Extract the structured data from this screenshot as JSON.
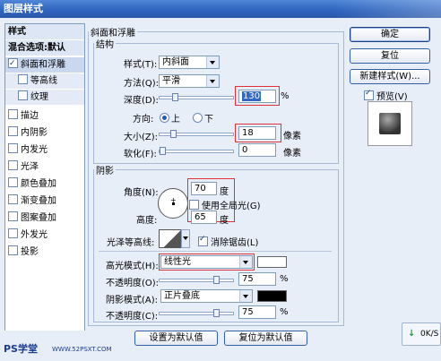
{
  "window": {
    "title": "图层样式"
  },
  "sidebar": {
    "header": "样式",
    "blend_options": "混合选项:默认",
    "items": [
      {
        "label": "斜面和浮雕",
        "checked": true,
        "selected": true
      },
      {
        "label": "等高线",
        "checked": false,
        "sub": true
      },
      {
        "label": "纹理",
        "checked": false,
        "sub": true
      },
      {
        "label": "描边",
        "checked": false
      },
      {
        "label": "内阴影",
        "checked": false
      },
      {
        "label": "内发光",
        "checked": false
      },
      {
        "label": "光泽",
        "checked": false
      },
      {
        "label": "颜色叠加",
        "checked": false
      },
      {
        "label": "渐变叠加",
        "checked": false
      },
      {
        "label": "图案叠加",
        "checked": false
      },
      {
        "label": "外发光",
        "checked": false
      },
      {
        "label": "投影",
        "checked": false
      }
    ]
  },
  "bevel": {
    "group_title": "斜面和浮雕",
    "structure": {
      "title": "结构",
      "style_label": "样式(T):",
      "style_value": "内斜面",
      "method_label": "方法(Q):",
      "method_value": "平滑",
      "depth_label": "深度(D):",
      "depth_value": "130",
      "depth_unit": "%",
      "direction_label": "方向:",
      "dir_up": "上",
      "dir_down": "下",
      "size_label": "大小(Z):",
      "size_value": "18",
      "size_unit": "像素",
      "soften_label": "软化(F):",
      "soften_value": "0",
      "soften_unit": "像素"
    },
    "shading": {
      "title": "阴影",
      "angle_label": "角度(N):",
      "angle_value": "70",
      "angle_unit": "度",
      "global_light_label": "使用全局光(G)",
      "altitude_label": "高度:",
      "altitude_value": "65",
      "altitude_unit": "度",
      "gloss_label": "光泽等高线:",
      "antialias_label": "消除锯齿(L)",
      "highlight_label": "高光模式(H):",
      "highlight_value": "线性光",
      "highlight_color": "#ffffff",
      "highlight_opacity_label": "不透明度(O):",
      "highlight_opacity_value": "75",
      "shadow_label": "阴影模式(A):",
      "shadow_value": "正片叠底",
      "shadow_color": "#000000",
      "shadow_opacity_label": "不透明度(C):",
      "shadow_opacity_value": "75",
      "percent": "%"
    }
  },
  "buttons": {
    "ok": "确定",
    "reset": "复位",
    "new_style": "新建样式(W)...",
    "preview_label": "预览(V)",
    "make_default": "设置为默认值",
    "reset_default": "复位为默认值"
  },
  "footer": {
    "watermark_left": "PS学堂",
    "watermark_site": "WWW.52PSXT.COM",
    "toast_text": "0K/S"
  }
}
